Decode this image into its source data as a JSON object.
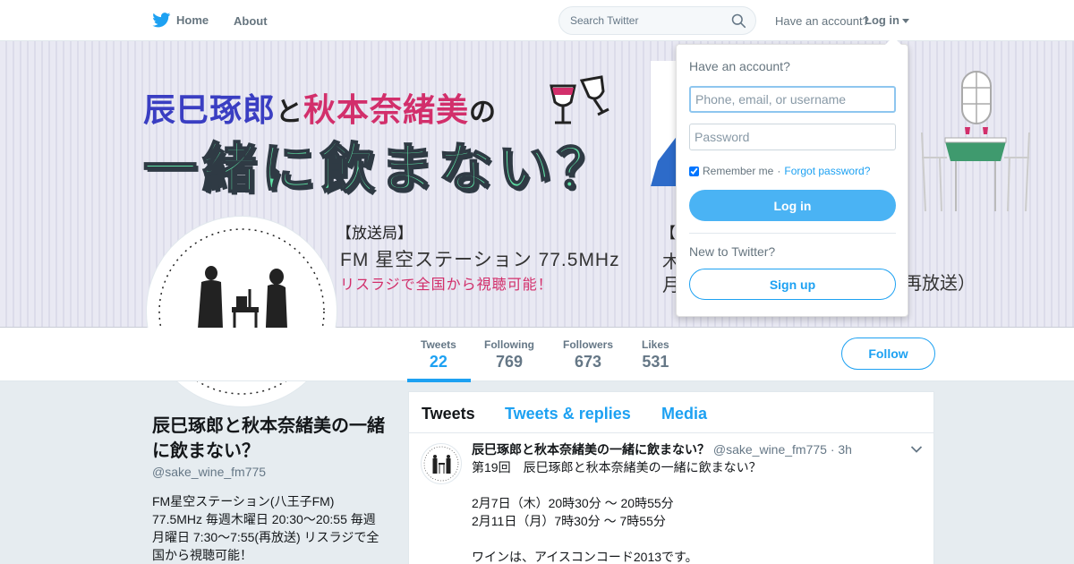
{
  "nav": {
    "home_label": "Home",
    "about_label": "About",
    "search_placeholder": "Search Twitter",
    "have_account_label": "Have an account?",
    "login_label": "Log in"
  },
  "banner": {
    "title_name1": "辰巳琢郎",
    "title_to": "と",
    "title_name2": "秋本奈緒美",
    "title_no": "の",
    "title_line2": "一緒に飲まない？",
    "station_heading": "【放送局】",
    "station_name": "FM 星空ステーション 77.5MHz",
    "station_note": "リスラジで全国から視聴可能！",
    "peek_heading": "【",
    "peek_line2": "木",
    "peek_line3": "月",
    "peek_right": "再放送）"
  },
  "profile": {
    "stats": [
      {
        "label": "Tweets",
        "value": "22"
      },
      {
        "label": "Following",
        "value": "769"
      },
      {
        "label": "Followers",
        "value": "673"
      },
      {
        "label": "Likes",
        "value": "531"
      }
    ],
    "follow_label": "Follow",
    "name": "辰巳琢郎と秋本奈緒美の一緒に飲まない？",
    "handle": "@sake_wine_fm775",
    "bio": "FM星空ステーション(八王子FM) 77.5MHz 毎週木曜日 20:30～20:55 毎週月曜日 7:30～7:55(再放送) リスラジで全国から視聴可能！"
  },
  "timeline": {
    "tabs": [
      "Tweets",
      "Tweets & replies",
      "Media"
    ],
    "tweet": {
      "name": "辰巳琢郎と秋本奈緒美の一緒に飲まない？",
      "handle": "@sake_wine_fm775",
      "time": "· 3h",
      "body": "第19回　辰巳琢郎と秋本奈緒美の一緒に飲まない？\n\n2月7日（木）20時30分 ～ 20時55分\n2月11日（月）7時30分 ～ 7時55分\n\nワインは、アイスコンコード2013です。"
    }
  },
  "dropdown": {
    "title": "Have an account?",
    "username_placeholder": "Phone, email, or username",
    "password_placeholder": "Password",
    "remember_label": "Remember me",
    "separator": "·",
    "forgot_label": "Forgot password?",
    "login_button": "Log in",
    "new_label": "New to Twitter?",
    "signup_button": "Sign up"
  },
  "colors": {
    "brand_blue": "#1da1f2",
    "banner_green": "#5ee0a4",
    "banner_blue": "#3a3ec2",
    "banner_pink": "#d22f6b"
  }
}
